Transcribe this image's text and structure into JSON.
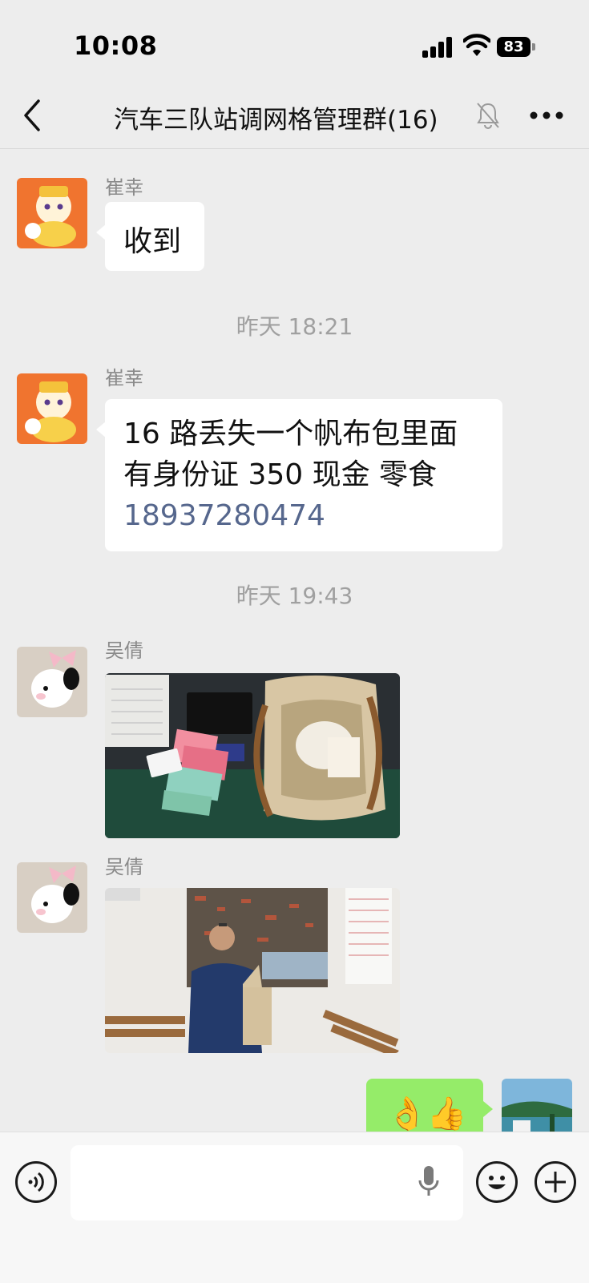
{
  "status_bar": {
    "time": "10:08",
    "battery": "83"
  },
  "header": {
    "title": "汽车三队站调网格管理群(16)"
  },
  "messages": [
    {
      "sender": "崔幸",
      "text": "收到"
    },
    {
      "timestamp": "昨天 18:21"
    },
    {
      "sender": "崔幸",
      "line1": "16 路丢失一个帆布包里面",
      "line2": "有身份证 350 现金  零食",
      "phone": "18937280474"
    },
    {
      "timestamp": "昨天 19:43"
    },
    {
      "sender": "吴倩",
      "image": "photo-cash-and-bag"
    },
    {
      "sender": "吴倩",
      "image": "photo-man-holding-bag"
    },
    {
      "outgoing_emoji": "👌👍"
    }
  ],
  "colors": {
    "bubble_out": "#95ec69",
    "link": "#56678d",
    "background": "#ededed"
  },
  "icons": [
    "back-icon",
    "mute-bell-icon",
    "more-icon",
    "voice-icon",
    "mic-icon",
    "emoji-icon",
    "plus-icon"
  ]
}
